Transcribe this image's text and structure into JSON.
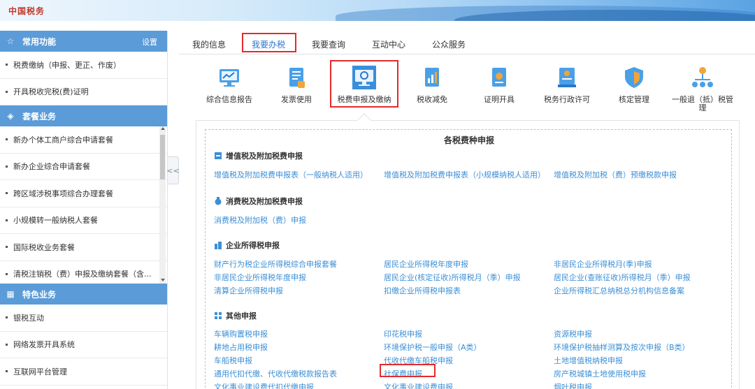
{
  "banner": {
    "logo": "中国税务"
  },
  "sidebar": {
    "common": {
      "title": "常用功能",
      "settings": "设置",
      "items": [
        "税费缴纳（申报、更正、作废）",
        "开具税收完税(费)证明"
      ]
    },
    "package": {
      "title": "套餐业务",
      "items": [
        "新办个体工商户综合申请套餐",
        "新办企业综合申请套餐",
        "跨区域涉税事项综合办理套餐",
        "小规模转一般纳税人套餐",
        "国际税收业务套餐",
        "清税注销税（费）申报及缴纳套餐（含..."
      ]
    },
    "special": {
      "title": "特色业务",
      "items": [
        "银税互动",
        "网络发票开具系统",
        "互联网平台管理"
      ]
    },
    "collapse": "<<"
  },
  "tabs": [
    "我的信息",
    "我要办税",
    "我要查询",
    "互动中心",
    "公众服务"
  ],
  "functions": [
    {
      "label": "综合信息报告",
      "icon": "report-icon"
    },
    {
      "label": "发票使用",
      "icon": "invoice-icon"
    },
    {
      "label": "税费申报及缴纳",
      "icon": "tax-declare-icon"
    },
    {
      "label": "税收减免",
      "icon": "tax-relief-icon"
    },
    {
      "label": "证明开具",
      "icon": "certificate-icon"
    },
    {
      "label": "税务行政许可",
      "icon": "license-icon"
    },
    {
      "label": "核定管理",
      "icon": "shield-icon"
    },
    {
      "label": "一般退（抵）税管理",
      "icon": "refund-icon"
    }
  ],
  "panel": {
    "title": "各税费种申报",
    "categories": [
      {
        "name": "增值税及附加税费申报",
        "links": [
          "增值税及附加税费申报表（一般纳税人适用）",
          "增值税及附加税费申报表（小规模纳税人适用）",
          "增值税及附加税（费）预缴税款申报"
        ]
      },
      {
        "name": "消费税及附加税费申报",
        "links": [
          "消费税及附加税（费）申报"
        ]
      },
      {
        "name": "企业所得税申报",
        "links": [
          "财产行为税企业所得税综合申报套餐",
          "居民企业所得税年度申报",
          "非居民企业所得税月(季)申报",
          "非居民企业所得税年度申报",
          "居民企业(核定征收)所得税月（季）申报",
          "居民企业(查账征收)所得税月（季）申报",
          "清算企业所得税申报",
          "扣缴企业所得税申报表",
          "企业所得税汇总纳税总分机构信息备案"
        ]
      },
      {
        "name": "其他申报",
        "links": [
          "车辆购置税申报",
          "印花税申报",
          "资源税申报",
          "耕地占用税申报",
          "环境保护税一般申报（A类）",
          "环境保护税抽样测算及按次申报（B类）",
          "车船税申报",
          "代收代缴车船税申报",
          "土地增值税纳税申报",
          "通用代扣代缴、代收代缴税款报告表",
          "社保费申报",
          "房产税城镇土地使用税申报",
          "文化事业建设费代扣代缴申报",
          "文化事业建设费申报",
          "烟叶税申报"
        ]
      }
    ]
  },
  "colors": {
    "accent": "#2a77cc",
    "link": "#3b8fd6",
    "sidebar_head": "#5a9bd8",
    "highlight": "#e32b2b"
  }
}
